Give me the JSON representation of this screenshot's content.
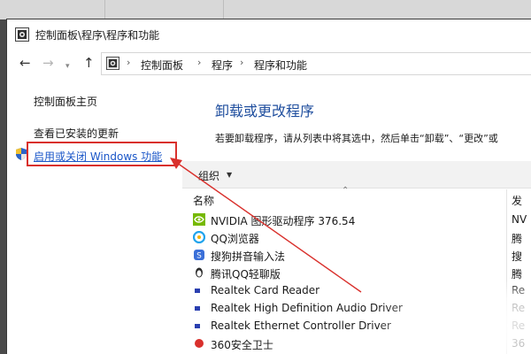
{
  "window": {
    "title": "控制面板\\程序\\程序和功能"
  },
  "address_bar": {
    "sep": "›",
    "crumbs": [
      "控制面板",
      "程序",
      "程序和功能"
    ]
  },
  "nav": {
    "back": "←",
    "forward": "→",
    "dropdown": "▾",
    "up": "↑"
  },
  "left_pane": {
    "home_link": "控制面板主页",
    "updates_link": "查看已安装的更新",
    "features_link": "启用或关闭 Windows 功能"
  },
  "main": {
    "heading": "卸载或更改程序",
    "description": "若要卸载程序，请从列表中将其选中，然后单击“卸载”、“更改”或",
    "toolbar": {
      "organize": "组织",
      "organize_caret": "▼"
    },
    "sort_arrow": "⌃",
    "columns": {
      "name": "名称",
      "publisher": "发"
    },
    "programs": [
      {
        "name": "NVIDIA 图形驱动程序 376.54",
        "publisher": "NV",
        "icon": "nvidia-icon",
        "color": "#76b900"
      },
      {
        "name": "QQ浏览器",
        "publisher": "腾",
        "icon": "qq-browser-icon",
        "color": "#1fa3ec"
      },
      {
        "name": "搜狗拼音输入法",
        "publisher": "搜",
        "icon": "sogou-icon",
        "color": "#3a6fd8"
      },
      {
        "name": "腾讯QQ轻聊版",
        "publisher": "腾",
        "icon": "qq-icon",
        "color": "#2b7de0"
      },
      {
        "name": "Realtek Card Reader",
        "publisher": "Re",
        "icon": "realtek-icon",
        "color": "#2a3fb0"
      },
      {
        "name": "Realtek High Definition Audio Driver",
        "publisher": "Re",
        "icon": "realtek-audio-icon",
        "color": "#2a3fb0"
      },
      {
        "name": "Realtek Ethernet Controller Driver",
        "publisher": "Re",
        "icon": "realtek-ethernet-icon",
        "color": "#2a3fb0"
      },
      {
        "name": "360安全卫士",
        "publisher": "36",
        "icon": "program-icon",
        "color": "#d9302c"
      }
    ]
  },
  "colors": {
    "highlight_red": "#d9302c",
    "link_blue": "#1a56c8",
    "heading_blue": "#1f4e9e"
  }
}
